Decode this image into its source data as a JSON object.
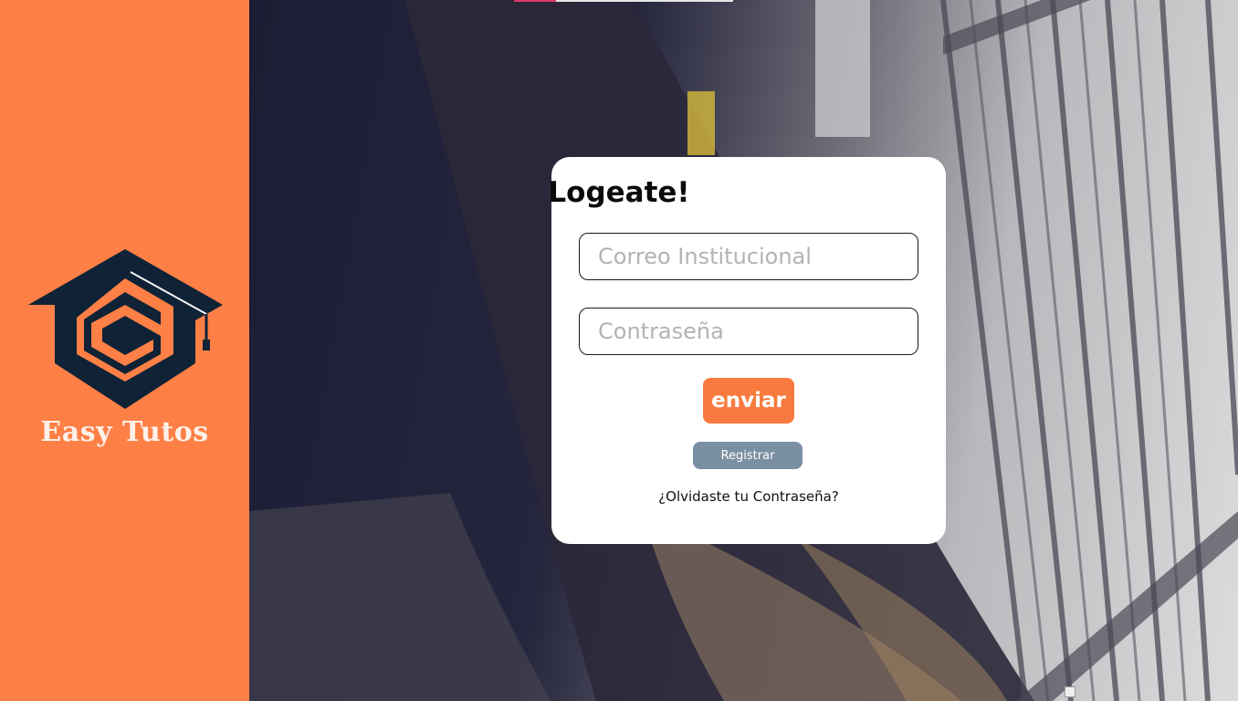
{
  "brand": {
    "name": "Easy Tutos",
    "logo_icon": "graduation-cap-hexagon-logo",
    "accent_color": "#ff8046",
    "logo_color": "#0f2236"
  },
  "login": {
    "title": "Logeate!",
    "email_placeholder": "Correo Institucional",
    "email_value": "",
    "password_placeholder": "Contraseña",
    "password_value": "",
    "submit_label": "enviar",
    "submit_color": "#f87a3e",
    "register_label": "Registrar",
    "register_color": "#7b8fa3",
    "forgot_label": "¿Olvidaste tu Contraseña?"
  },
  "background": {
    "image_icon": "library-bookshelves-photo"
  }
}
